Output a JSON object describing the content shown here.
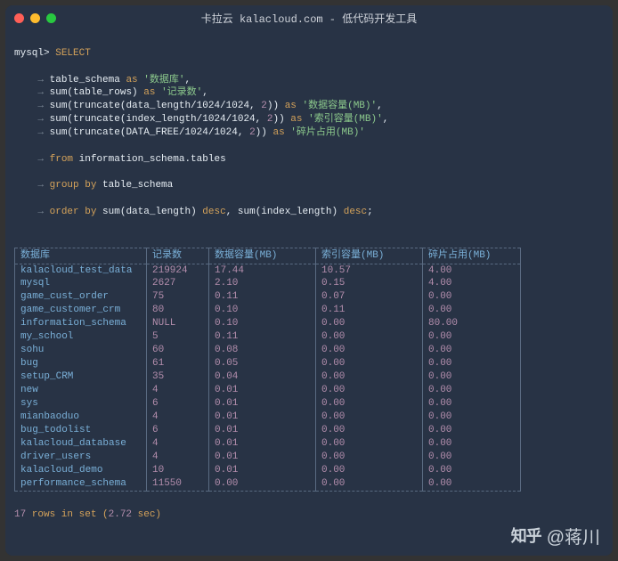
{
  "window": {
    "title": "卡拉云 kalacloud.com - 低代码开发工具"
  },
  "prompt": "mysql>",
  "arrow": "→",
  "sql": {
    "select": "SELECT",
    "lines": [
      {
        "pre": "table_schema ",
        "kw": "as",
        "post": " ",
        "str": "'数据库'",
        "tail": ","
      },
      {
        "pre": "sum(table_rows) ",
        "kw": "as",
        "post": " ",
        "str": "'记录数'",
        "tail": ","
      },
      {
        "pre": "sum(truncate(data_length/1024/1024, ",
        "num": "2",
        "mid": ")) ",
        "kw": "as",
        "post": " ",
        "str": "'数据容量(MB)'",
        "tail": ","
      },
      {
        "pre": "sum(truncate(index_length/1024/1024, ",
        "num": "2",
        "mid": ")) ",
        "kw": "as",
        "post": " ",
        "str": "'索引容量(MB)'",
        "tail": ","
      },
      {
        "pre": "sum(truncate(DATA_FREE/1024/1024, ",
        "num": "2",
        "mid": ")) ",
        "kw": "as",
        "post": " ",
        "str": "'碎片占用(MB)'",
        "tail": ""
      }
    ],
    "from_kw": "from",
    "from_tbl": "information_schema.tables",
    "group_kw": "group by",
    "group_col": "table_schema",
    "order_kw": "order by",
    "order_a": "sum(data_length)",
    "order_b": "sum(index_length)",
    "desc": "desc",
    "comma": ", ",
    "semicolon": ";"
  },
  "headers": [
    "数据库",
    "记录数",
    "数据容量(MB)",
    "索引容量(MB)",
    "碎片占用(MB)"
  ],
  "rows": [
    {
      "db": "kalacloud_test_data",
      "rec": "219924",
      "data": "17.44",
      "idx": "10.57",
      "frag": "4.00"
    },
    {
      "db": "mysql",
      "rec": "2627",
      "data": "2.10",
      "idx": "0.15",
      "frag": "4.00"
    },
    {
      "db": "game_cust_order",
      "rec": "75",
      "data": "0.11",
      "idx": "0.07",
      "frag": "0.00"
    },
    {
      "db": "game_customer_crm",
      "rec": "80",
      "data": "0.10",
      "idx": "0.11",
      "frag": "0.00"
    },
    {
      "db": "information_schema",
      "rec": "NULL",
      "data": "0.10",
      "idx": "0.00",
      "frag": "80.00"
    },
    {
      "db": "my_school",
      "rec": "5",
      "data": "0.11",
      "idx": "0.00",
      "frag": "0.00"
    },
    {
      "db": "sohu",
      "rec": "60",
      "data": "0.08",
      "idx": "0.00",
      "frag": "0.00"
    },
    {
      "db": "bug",
      "rec": "61",
      "data": "0.05",
      "idx": "0.00",
      "frag": "0.00"
    },
    {
      "db": "setup_CRM",
      "rec": "35",
      "data": "0.04",
      "idx": "0.00",
      "frag": "0.00"
    },
    {
      "db": "new",
      "rec": "4",
      "data": "0.01",
      "idx": "0.00",
      "frag": "0.00"
    },
    {
      "db": "sys",
      "rec": "6",
      "data": "0.01",
      "idx": "0.00",
      "frag": "0.00"
    },
    {
      "db": "mianbaoduo",
      "rec": "4",
      "data": "0.01",
      "idx": "0.00",
      "frag": "0.00"
    },
    {
      "db": "bug_todolist",
      "rec": "6",
      "data": "0.01",
      "idx": "0.00",
      "frag": "0.00"
    },
    {
      "db": "kalacloud_database",
      "rec": "4",
      "data": "0.01",
      "idx": "0.00",
      "frag": "0.00"
    },
    {
      "db": "driver_users",
      "rec": "4",
      "data": "0.01",
      "idx": "0.00",
      "frag": "0.00"
    },
    {
      "db": "kalacloud_demo",
      "rec": "10",
      "data": "0.01",
      "idx": "0.00",
      "frag": "0.00"
    },
    {
      "db": "performance_schema",
      "rec": "11550",
      "data": "0.00",
      "idx": "0.00",
      "frag": "0.00"
    }
  ],
  "status": {
    "count": "17",
    "mid": " rows in set (",
    "time": "2.72",
    "tail": " sec)"
  },
  "watermark": {
    "logo": "知乎",
    "author": "@蒋川"
  }
}
